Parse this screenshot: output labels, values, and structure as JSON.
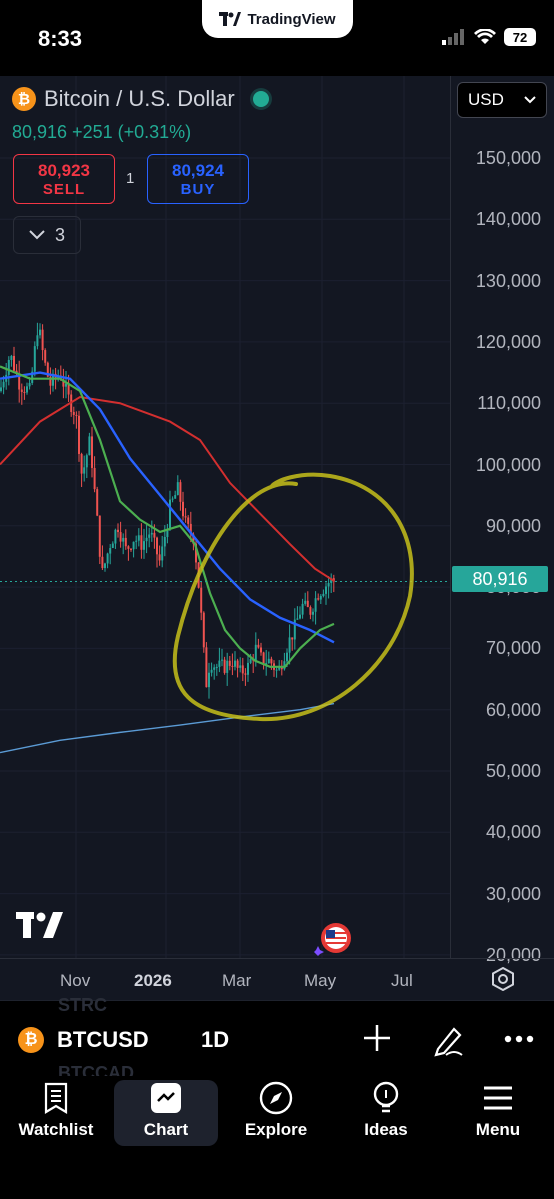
{
  "status_bar": {
    "time": "8:33",
    "app_pill": "TradingView",
    "battery": "72"
  },
  "header": {
    "coin_glyph": "₿",
    "title": "Bitcoin / U.S. Dollar",
    "currency": "USD",
    "quote": "80,916 +251 (+0.31%)",
    "sell": {
      "value": "80,923",
      "label": "SELL"
    },
    "buy": {
      "value": "80,924",
      "label": "BUY"
    },
    "quantity": "1",
    "indicator_count": "3"
  },
  "chart_data": {
    "type": "line",
    "title": "",
    "ylim": [
      20000,
      150000
    ],
    "y_ticks": [
      "150,000",
      "140,000",
      "130,000",
      "120,000",
      "110,000",
      "100,000",
      "90,000",
      "80,000",
      "70,000",
      "60,000",
      "50,000",
      "40,000",
      "30,000",
      "20,000"
    ],
    "x_ticks": [
      "Nov",
      "2026",
      "Mar",
      "May",
      "Jul"
    ],
    "last_price_label": "80,916",
    "series": [
      {
        "color": "#ef5350",
        "role": "candles"
      },
      {
        "color": "#4caf50",
        "role": "moving-average"
      },
      {
        "color": "#2962ff",
        "role": "moving-average"
      },
      {
        "color": "#d32f2f",
        "role": "moving-average"
      },
      {
        "color": "#5b9bd5",
        "role": "moving-average"
      }
    ],
    "annotation": {
      "shape": "freehand ellipse",
      "color": "#c7c01a"
    }
  },
  "bottom_bar": {
    "symbol": "BTCUSD",
    "interval": "1D",
    "ghost_top": "STRC",
    "ghost_bottom": "BTCCAD"
  },
  "nav": [
    {
      "label": "Watchlist",
      "icon": "watchlist-icon"
    },
    {
      "label": "Chart",
      "icon": "chart-icon"
    },
    {
      "label": "Explore",
      "icon": "compass-icon"
    },
    {
      "label": "Ideas",
      "icon": "lightbulb-icon"
    },
    {
      "label": "Menu",
      "icon": "menu-icon"
    }
  ],
  "colors": {
    "background": "#131722",
    "up": "#26a69a",
    "down": "#ef5350",
    "accent": "#2962ff"
  }
}
